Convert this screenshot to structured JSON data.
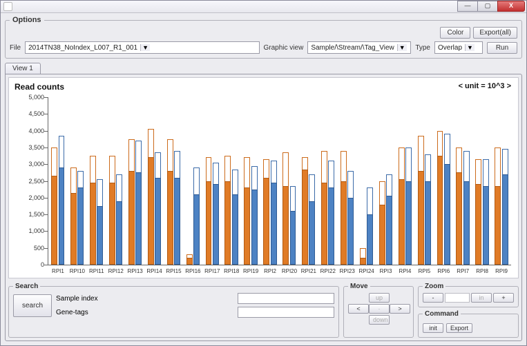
{
  "titlebar": {
    "close": "X"
  },
  "options": {
    "legend": "Options",
    "color_btn": "Color",
    "export_btn": "Export(all)",
    "file_label": "File",
    "file_value": "2014TN38_NoIndex_L007_R1_001",
    "graphic_view_label": "Graphic view",
    "graphic_view_value": "Sample/\\Stream/\\Tag_View",
    "type_label": "Type",
    "type_value": "Overlap",
    "run_btn": "Run"
  },
  "tabs": {
    "view1": "View 1"
  },
  "chart_data": {
    "type": "bar",
    "title": "Read counts",
    "unit_label": "< unit = 10^3 >",
    "ylim": [
      0,
      5000
    ],
    "yticks": [
      0,
      500,
      1000,
      1500,
      2000,
      2500,
      3000,
      3500,
      4000,
      4500,
      5000
    ],
    "categories": [
      "RPI1",
      "RPI10",
      "RPI11",
      "RPI12",
      "RPI13",
      "RPI14",
      "RPI15",
      "RPI16",
      "RPI17",
      "RPI18",
      "RPI19",
      "RPI2",
      "RPI20",
      "RPI21",
      "RPI22",
      "RPI23",
      "RPI24",
      "RPI3",
      "RPI4",
      "RPI5",
      "RPI6",
      "RPI7",
      "RPI8",
      "RPI9"
    ],
    "series": [
      {
        "name": "s1_open",
        "color": "#ffffff",
        "border": "#cc6a1a",
        "values": [
          3500,
          2900,
          3250,
          3250,
          3750,
          4050,
          3750,
          300,
          3200,
          3250,
          3200,
          3150,
          3350,
          3200,
          3400,
          3400,
          500,
          2500,
          3500,
          3850,
          4000,
          3500,
          3150,
          3500
        ]
      },
      {
        "name": "s1_filled",
        "color": "#e07b26",
        "border": "#b35a12",
        "values": [
          2650,
          2150,
          2450,
          2450,
          2800,
          3200,
          2800,
          200,
          2500,
          2500,
          2300,
          2600,
          2350,
          2850,
          2450,
          2500,
          200,
          1800,
          2550,
          2800,
          3250,
          2750,
          2400,
          2350
        ]
      },
      {
        "name": "s2_open",
        "color": "#ffffff",
        "border": "#3a6aa8",
        "values": [
          3850,
          2800,
          2550,
          2700,
          3700,
          3350,
          3400,
          2900,
          3050,
          2850,
          2950,
          3100,
          2350,
          2700,
          3100,
          2800,
          2300,
          2700,
          3500,
          3300,
          3900,
          3400,
          3150,
          3450
        ]
      },
      {
        "name": "s2_filled",
        "color": "#4d82c3",
        "border": "#2d5a94",
        "values": [
          2900,
          2300,
          1750,
          1900,
          2750,
          2600,
          2600,
          2100,
          2400,
          2100,
          2250,
          2450,
          1600,
          1900,
          2300,
          2000,
          1500,
          2050,
          2500,
          2500,
          3000,
          2500,
          2350,
          2700
        ]
      }
    ]
  },
  "search": {
    "legend": "Search",
    "sample_index_label": "Sample index",
    "gene_tags_label": "Gene-tags",
    "search_btn": "search"
  },
  "move": {
    "legend": "Move",
    "up": "up",
    "left": "<",
    "center": "·",
    "right": ">",
    "down": "down"
  },
  "zoom": {
    "legend": "Zoom",
    "minus": "-",
    "in": "in",
    "plus": "+"
  },
  "command": {
    "legend": "Command",
    "init": "init",
    "export": "Export"
  }
}
